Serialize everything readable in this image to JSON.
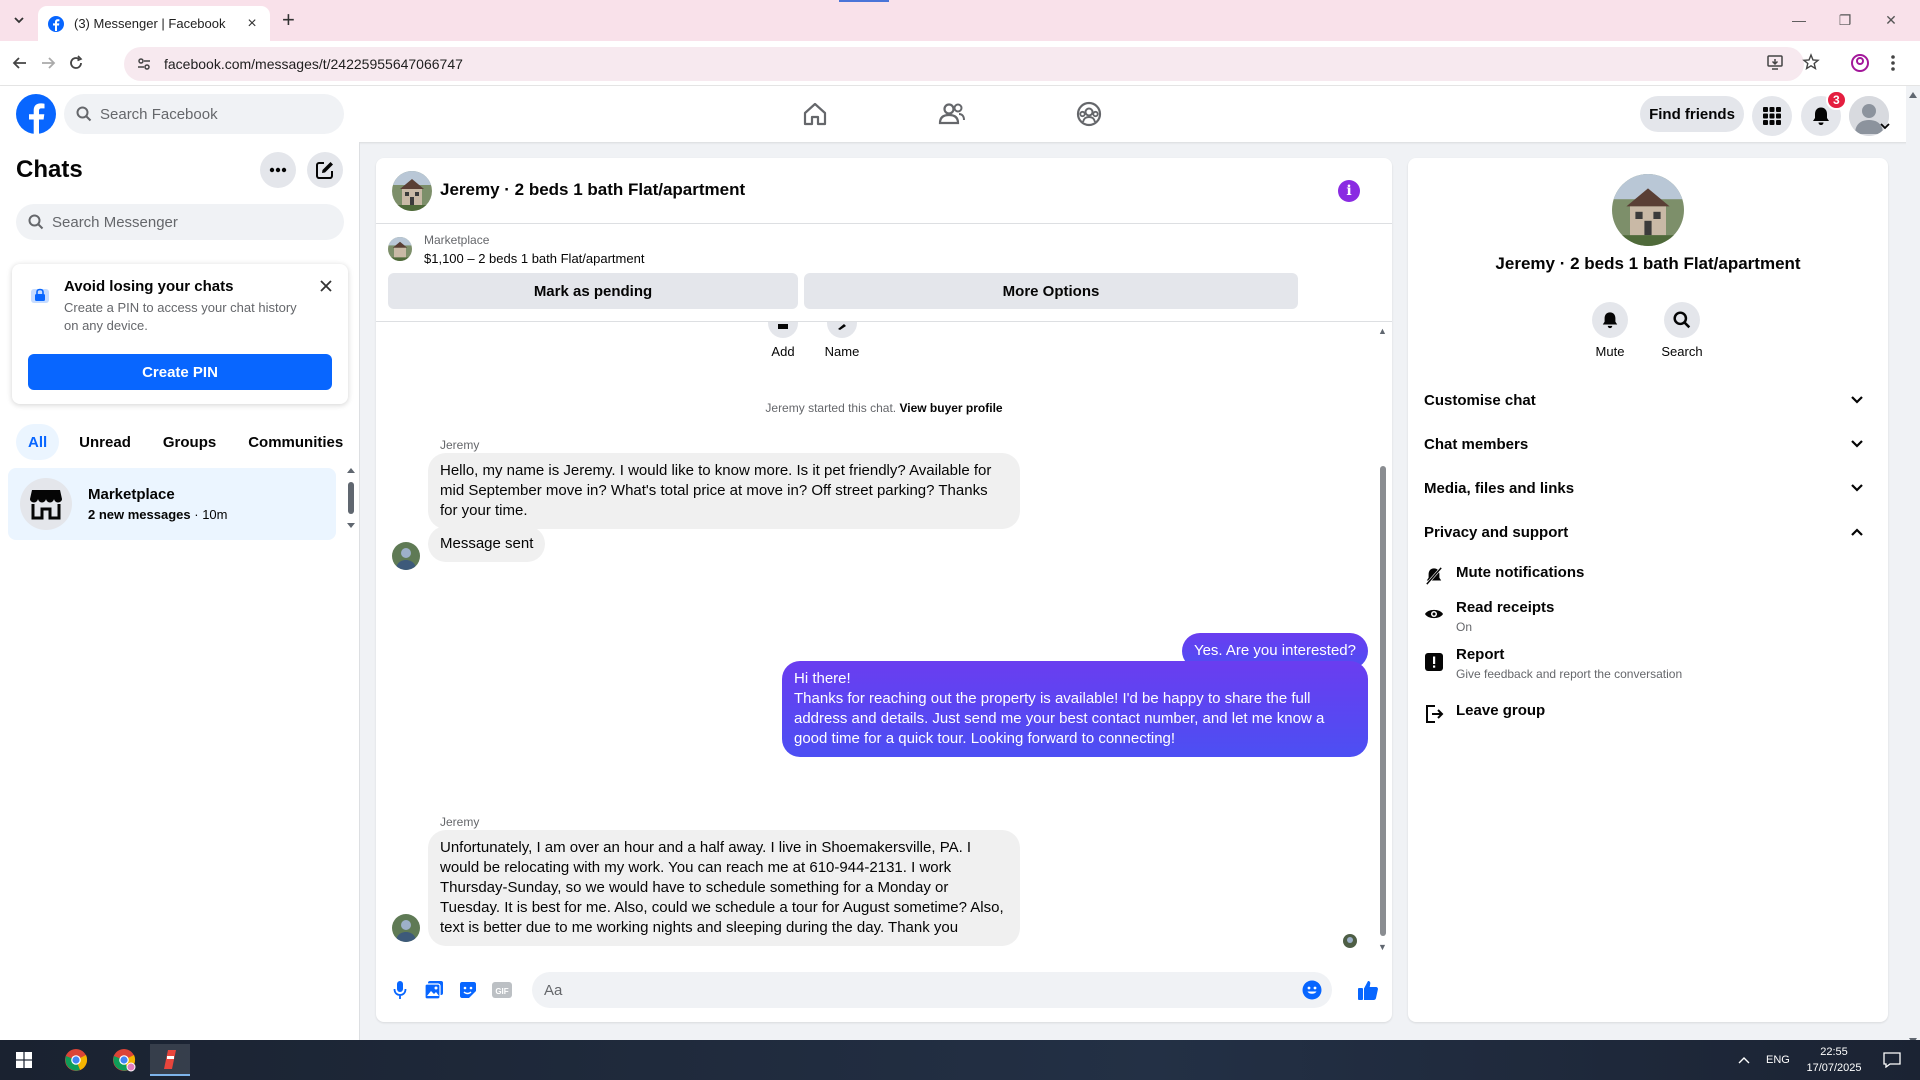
{
  "browser": {
    "tab_title": "(3) Messenger | Facebook",
    "url": "facebook.com/messages/t/24225955647066747"
  },
  "fbnav": {
    "search_placeholder": "Search Facebook",
    "find_friends": "Find friends",
    "notification_count": "3"
  },
  "sidebar": {
    "title": "Chats",
    "search_placeholder": "Search Messenger",
    "pin_card": {
      "title": "Avoid losing your chats",
      "description": "Create a PIN to access your chat history on any device.",
      "button": "Create PIN"
    },
    "filters": [
      "All",
      "Unread",
      "Groups",
      "Communities"
    ],
    "conversation": {
      "name": "Marketplace",
      "new_messages": "2 new messages",
      "time": "· 10m"
    }
  },
  "chat": {
    "title": "Jeremy · 2 beds 1 bath Flat/apartment",
    "marketplace_label": "Marketplace",
    "listing": "$1,100 – 2 beds 1 bath Flat/apartment",
    "mark_pending": "Mark as pending",
    "more_options": "More Options",
    "top_actions": [
      "Add",
      "Name"
    ],
    "started_text": "Jeremy started this chat.",
    "view_profile": "View buyer profile",
    "messages": [
      {
        "sender": "Jeremy",
        "lines": [
          "Hello, my name is Jeremy. I would like to know more. Is it pet friendly? Available for",
          "mid September move in? What's total price at move in? Off street parking? Thanks",
          "for your time."
        ]
      },
      {
        "lines": [
          "Message sent"
        ]
      },
      {
        "lines": [
          "Yes. Are you interested?"
        ]
      },
      {
        "lines": [
          "Hi there!",
          "Thanks for reaching out the property is available! I'd be happy to share the full",
          "address and details. Just send me your best contact number, and let me know a",
          "good time for a quick tour. Looking forward to connecting!"
        ]
      },
      {
        "sender": "Jeremy",
        "lines": [
          "Unfortunately, I am over an hour and a half away. I live in Shoemakersville, PA. I",
          "would be relocating with my work. You can reach me at 610-944-2131. I work",
          "Thursday-Sunday, so we would have to schedule something for a Monday or",
          "Tuesday. It is best for me. Also, could we schedule a tour for August sometime? Also,",
          "text is better due to me working nights and sleeping during the day. Thank you"
        ]
      }
    ],
    "composer_placeholder": "Aa"
  },
  "info": {
    "name": "Jeremy · 2 beds 1 bath Flat/apartment",
    "buttons": [
      "Mute",
      "Search"
    ],
    "sections": [
      "Customise chat",
      "Chat members",
      "Media, files and links",
      "Privacy and support"
    ],
    "privacy_items": [
      {
        "label": "Mute notifications",
        "sub": ""
      },
      {
        "label": "Read receipts",
        "sub": "On"
      },
      {
        "label": "Report",
        "sub": "Give feedback and report the conversation"
      },
      {
        "label": "Leave group",
        "sub": ""
      }
    ]
  },
  "taskbar": {
    "lang": "ENG",
    "time": "22:55",
    "date": "17/07/2025"
  },
  "colors": {
    "fb_blue": "#0866ff",
    "outgoing_bubble": "#5046f0",
    "notification_red": "#e41e3f"
  }
}
